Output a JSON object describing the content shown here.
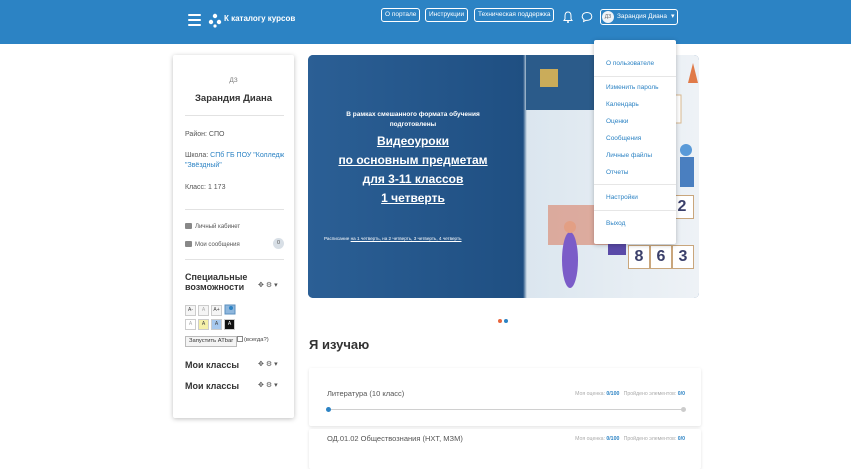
{
  "header": {
    "catalog_link": "К каталогу курсов",
    "buttons": [
      "О портале",
      "Инструкции",
      "Техническая поддержка"
    ],
    "user_initials": "ДЗ",
    "user_name": "Зарандия Диана"
  },
  "sidebar": {
    "initials": "ДЗ",
    "name": "Зарандия Диана",
    "district_label": "Район: ",
    "district_value": "СПО",
    "school_label": "Школа: ",
    "school_value": "СПб ГБ ПОУ \"Колледж \"Звёздный\"",
    "class_label": "Класс: ",
    "class_value": "1 173",
    "cabinet_link": "Личный кабинет",
    "messages_link": "Мои сообщения",
    "messages_count": "0",
    "accessibility_title": "Специальные возможности",
    "font_buttons": [
      "A-",
      "A",
      "A+"
    ],
    "color_buttons": [
      "A",
      "A",
      "A",
      "A"
    ],
    "atbar_button": "Запустить ATbar",
    "atbar_always": "(всегда?)",
    "my_classes_1": "Мои классы",
    "my_classes_2": "Мои классы"
  },
  "banner": {
    "line1": "В рамках смешанного формата обучения",
    "line2": "подготовлены",
    "big1": "Видеоуроки",
    "big2": "по основным предметам",
    "big3": "для 3-11 классов",
    "big4": "1 четверть",
    "schedule_prefix": "Расписание ",
    "schedule_links": "на 1 четверть, на 2 четверть, 3 четверть, 4 четверть",
    "numbers_row1": [
      "2"
    ],
    "numbers_row2": [
      "8",
      "6",
      "3"
    ],
    "dots": [
      "#e8663d",
      "#2c83c4"
    ]
  },
  "user_menu": {
    "items": [
      "О пользователе",
      "Изменить пароль",
      "Календарь",
      "Оценки",
      "Сообщения",
      "Личные файлы",
      "Отчеты",
      "Настройки",
      "Выход"
    ]
  },
  "main": {
    "section_title": "Я изучаю",
    "courses": [
      {
        "title": "Литература (10 класс)",
        "grade_label": "Моя оценка: ",
        "grade": "0/100",
        "passed_label": "Пройдено элементов: ",
        "passed": "0/0",
        "progress": 0
      },
      {
        "title": "ОД.01.02 Обществознания (НХТ, МЗМ)",
        "grade_label": "Моя оценка: ",
        "grade": "0/100",
        "passed_label": "Пройдено элементов: ",
        "passed": "0/0",
        "progress": 0
      }
    ]
  },
  "colors": {
    "accent": "#2c83c4",
    "banner": "#2a5c90"
  }
}
